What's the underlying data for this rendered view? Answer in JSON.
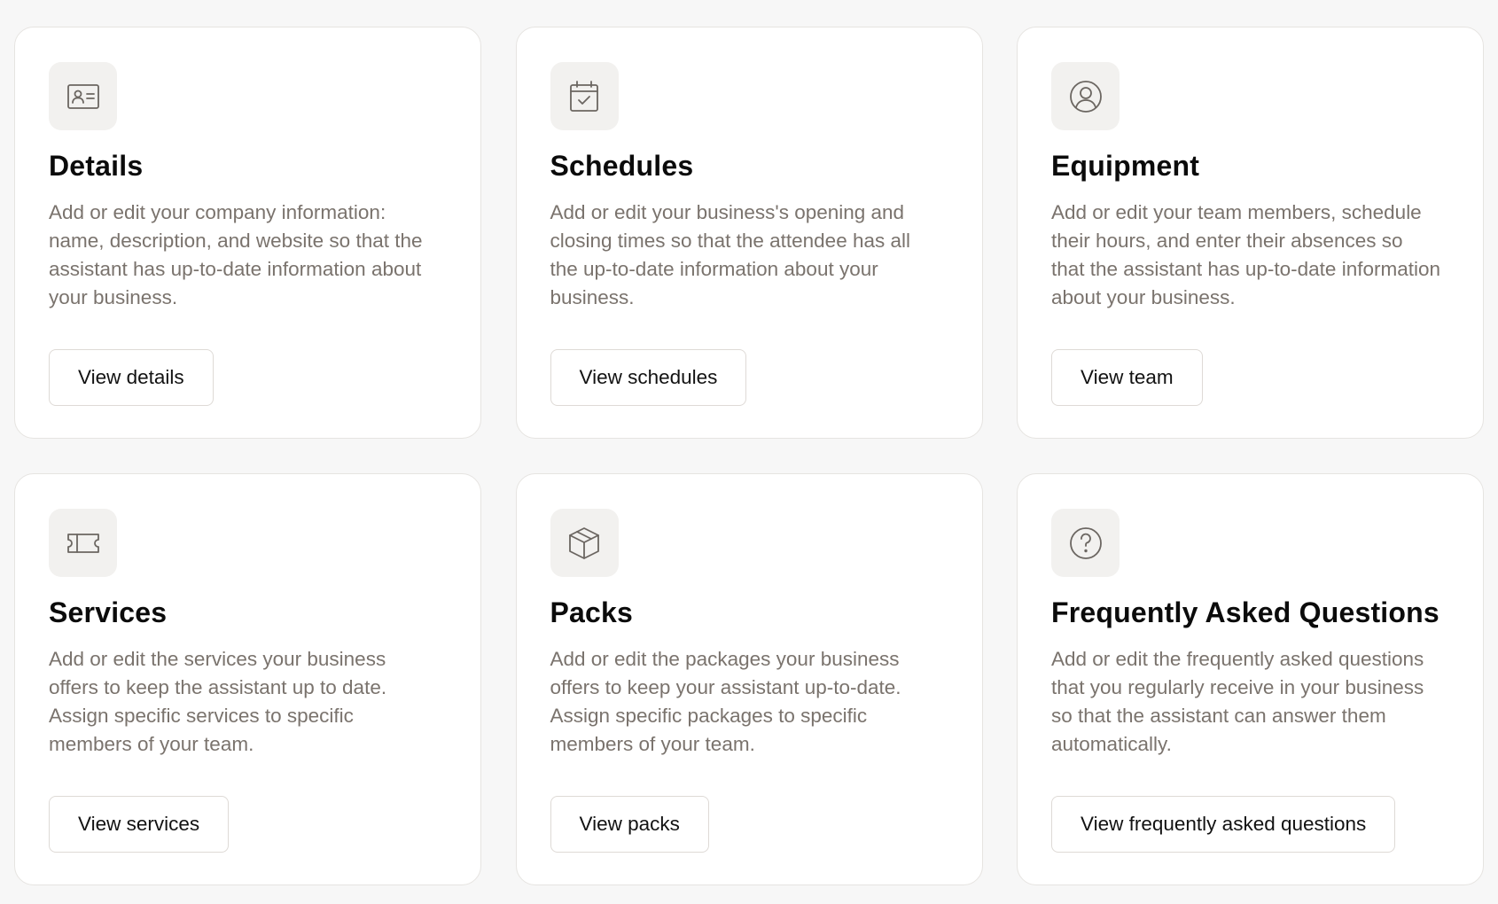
{
  "cards": [
    {
      "icon": "id-card-icon",
      "title": "Details",
      "description": "Add or edit your company information: name, description, and website so that the assistant has up-to-date information about your business.",
      "button": "View details"
    },
    {
      "icon": "calendar-check-icon",
      "title": "Schedules",
      "description": "Add or edit your business's opening and closing times so that the attendee has all the up-to-date information about your business.",
      "button": "View schedules"
    },
    {
      "icon": "user-circle-icon",
      "title": "Equipment",
      "description": "Add or edit your team members, schedule their hours, and enter their absences so that the assistant has up-to-date information about your business.",
      "button": "View team"
    },
    {
      "icon": "ticket-icon",
      "title": "Services",
      "description": "Add or edit the services your business offers to keep the assistant up to date. Assign specific services to specific members of your team.",
      "button": "View services"
    },
    {
      "icon": "box-icon",
      "title": "Packs",
      "description": "Add or edit the packages your business offers to keep your assistant up-to-date. Assign specific packages to specific members of your team.",
      "button": "View packs"
    },
    {
      "icon": "question-circle-icon",
      "title": "Frequently Asked Questions",
      "description": "Add or edit the frequently asked questions that you regularly receive in your business so that the assistant can answer them automatically.",
      "button": "View frequently asked questions"
    }
  ],
  "colors": {
    "page_background": "#f7f7f7",
    "card_background": "#ffffff",
    "icon_background": "#f2f1ef",
    "icon_stroke": "#6b6661",
    "description_text": "#7a736d",
    "title_text": "#0b0b0b"
  }
}
